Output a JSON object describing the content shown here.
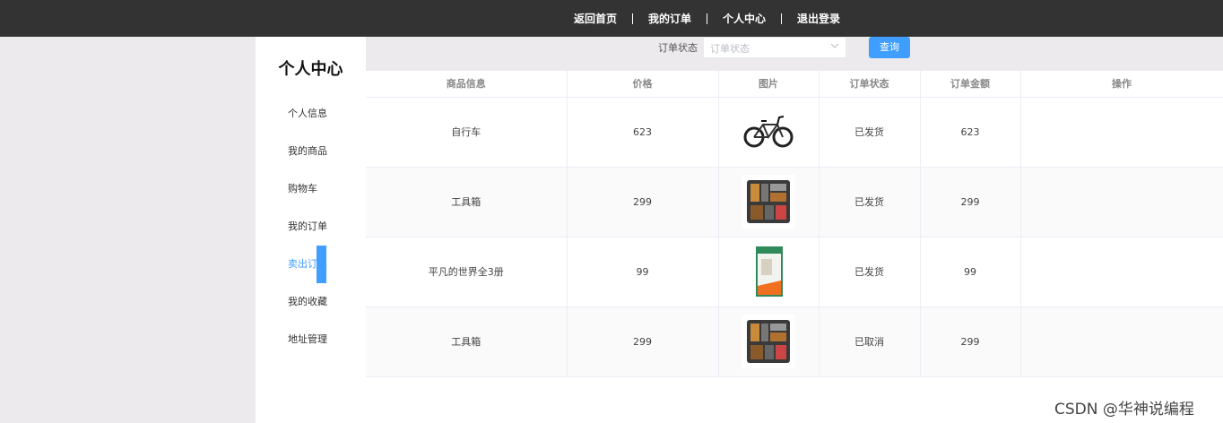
{
  "topnav": {
    "items": [
      "返回首页",
      "我的订单",
      "个人中心",
      "退出登录"
    ]
  },
  "sidebar": {
    "title": "个人中心",
    "items": [
      {
        "label": "个人信息"
      },
      {
        "label": "我的商品"
      },
      {
        "label": "购物车"
      },
      {
        "label": "我的订单"
      },
      {
        "label": "卖出订单"
      },
      {
        "label": "我的收藏"
      },
      {
        "label": "地址管理"
      }
    ]
  },
  "filter": {
    "label": "订单状态",
    "placeholder": "订单状态",
    "query_label": "查询"
  },
  "table": {
    "headers": [
      "商品信息",
      "价格",
      "图片",
      "订单状态",
      "订单金额",
      "操作"
    ],
    "rows": [
      {
        "name": "自行车",
        "price": "623",
        "image": "bicycle-image",
        "status": "已发货",
        "amount": "623",
        "action": ""
      },
      {
        "name": "工具箱",
        "price": "299",
        "image": "toolbox-image",
        "status": "已发货",
        "amount": "299",
        "action": ""
      },
      {
        "name": "平凡的世界全3册",
        "price": "99",
        "image": "book-image",
        "status": "已发货",
        "amount": "99",
        "action": ""
      },
      {
        "name": "工具箱",
        "price": "299",
        "image": "toolbox-image",
        "status": "已取消",
        "amount": "299",
        "action": ""
      }
    ]
  },
  "watermark": "CSDN @华神说编程",
  "colors": {
    "accent": "#409eff",
    "topbar": "#333333",
    "background": "#eceaec"
  }
}
